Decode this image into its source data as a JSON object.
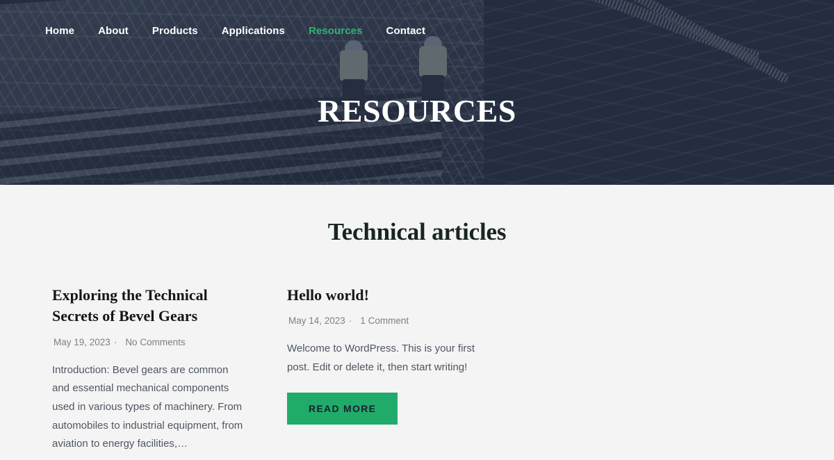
{
  "nav": {
    "items": [
      {
        "label": "Home",
        "active": false
      },
      {
        "label": "About",
        "active": false
      },
      {
        "label": "Products",
        "active": false
      },
      {
        "label": "Applications",
        "active": false
      },
      {
        "label": "Resources",
        "active": true
      },
      {
        "label": "Contact",
        "active": false
      }
    ]
  },
  "hero": {
    "title": "RESOURCES"
  },
  "main": {
    "section_title": "Technical articles",
    "posts": [
      {
        "title": "Exploring the Technical Secrets of Bevel Gears",
        "date": "May 19, 2023",
        "separator": "·",
        "comments": "No Comments",
        "excerpt": "Introduction: Bevel gears are common and essential mechanical components used in various types of machinery. From automobiles to industrial equipment, from aviation to energy facilities,…",
        "read_more": null
      },
      {
        "title": "Hello world!",
        "date": "May 14, 2023",
        "separator": "·",
        "comments": "1 Comment",
        "excerpt": "Welcome to WordPress. This is your first post. Edit or delete it, then start writing!",
        "read_more": "READ MORE"
      }
    ]
  },
  "colors": {
    "accent_green": "#21ab6b",
    "nav_active_green": "#2bb673",
    "hero_overlay": "#212a3c",
    "page_background": "#f4f4f4",
    "heading": "#19261f",
    "body_text": "#4f5661",
    "meta_text": "#7b7f86",
    "button_text": "#17212b"
  }
}
